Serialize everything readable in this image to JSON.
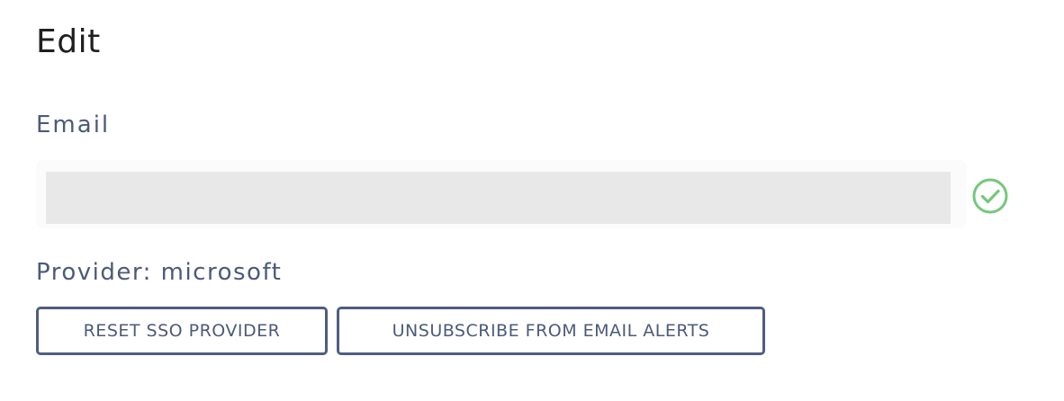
{
  "page": {
    "title": "Edit"
  },
  "email": {
    "label": "Email",
    "value": "",
    "status_icon": "check-circle-icon",
    "status_color": "#74c87a"
  },
  "provider": {
    "text": "Provider: microsoft"
  },
  "actions": {
    "reset_label": "RESET SSO PROVIDER",
    "unsubscribe_label": "UNSUBSCRIBE FROM EMAIL ALERTS"
  },
  "colors": {
    "text_primary": "#1f1f1f",
    "text_secondary": "#4c5a7a",
    "button_border": "#4f5d80",
    "input_bg": "#e8e8e8"
  }
}
